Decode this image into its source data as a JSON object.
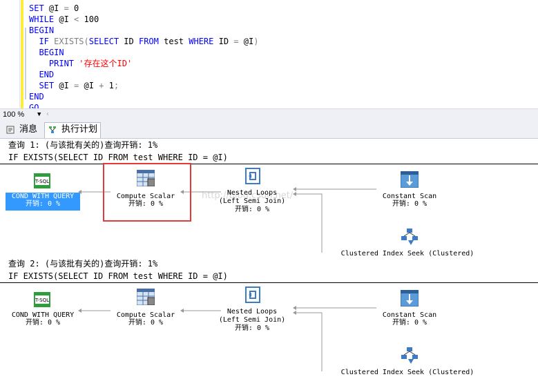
{
  "editor": {
    "lines": [
      "SET @I = 0",
      "WHILE @I < 100",
      "BEGIN",
      "  IF EXISTS(SELECT ID FROM test WHERE ID = @I)",
      "  BEGIN",
      "    PRINT '存在这个ID'",
      "  END",
      "  SET @I = @I + 1;",
      "END",
      "GO"
    ]
  },
  "zoom": {
    "value": "100 %"
  },
  "tabs": [
    {
      "label": "消息"
    },
    {
      "label": "执行计划"
    }
  ],
  "queries": [
    {
      "header": "查询 1: (与该批有关的)查询开销: 1%",
      "sql": "IF EXISTS(SELECT ID FROM test WHERE ID = @I)",
      "nodes": {
        "cond": {
          "name": "COND WITH QUERY",
          "cost": "开销: 0 %",
          "icon_text": "T-SQL"
        },
        "compute": {
          "name": "Compute Scalar",
          "cost": "开销: 0 %"
        },
        "nested": {
          "name": "Nested Loops",
          "sub": "(Left Semi Join)",
          "cost": "开销: 0 %"
        },
        "constant": {
          "name": "Constant Scan",
          "cost": "开销: 0 %"
        },
        "seek": {
          "name": "Clustered Index Seek (Clustered)"
        }
      }
    },
    {
      "header": "查询 2: (与该批有关的)查询开销: 1%",
      "sql": "IF EXISTS(SELECT ID FROM test WHERE ID = @I)",
      "nodes": {
        "cond": {
          "name": "COND WITH QUERY",
          "cost": "开销: 0 %",
          "icon_text": "T-SQL"
        },
        "compute": {
          "name": "Compute Scalar",
          "cost": "开销: 0 %"
        },
        "nested": {
          "name": "Nested Loops",
          "sub": "(Left Semi Join)",
          "cost": "开销: 0 %"
        },
        "constant": {
          "name": "Constant Scan",
          "cost": "开销: 0 %"
        },
        "seek": {
          "name": "Clustered Index Seek (Clustered)"
        }
      }
    }
  ],
  "watermark": "http://blog.csdn.net/",
  "colors": {
    "keyword": "#0000ff",
    "string": "#ff0000",
    "function": "#ff00ff",
    "selection": "#3399ff",
    "highlight_box": "#e23a3a"
  }
}
